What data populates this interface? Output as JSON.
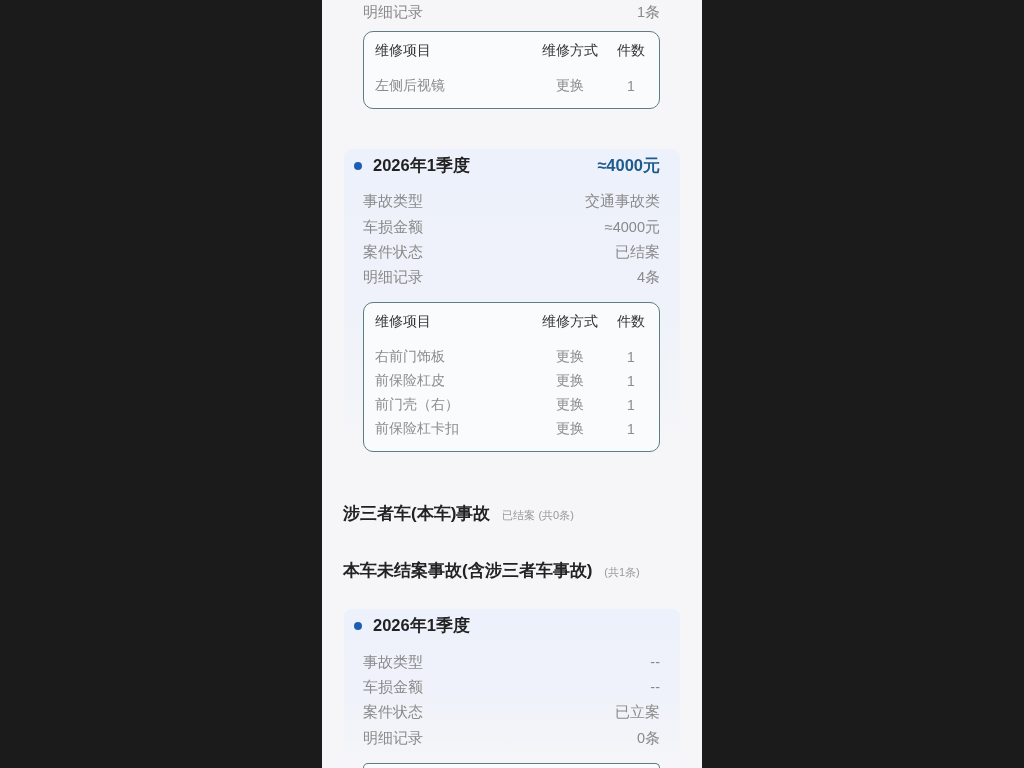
{
  "items": [
    {
      "kind": "record",
      "details": [
        {
          "label": "明细记录",
          "value": "1条"
        }
      ],
      "repairs": {
        "columns": [
          "维修项目",
          "维修方式",
          "件数"
        ],
        "rows": [
          {
            "item": "左侧后视镜",
            "method": "更换",
            "count": "1"
          }
        ]
      }
    },
    {
      "kind": "record",
      "period": "2026年1季度",
      "amount": "≈4000元",
      "details": [
        {
          "label": "事故类型",
          "value": "交通事故类"
        },
        {
          "label": "车损金额",
          "value": "≈4000元"
        },
        {
          "label": "案件状态",
          "value": "已结案"
        },
        {
          "label": "明细记录",
          "value": "4条"
        }
      ],
      "repairs": {
        "columns": [
          "维修项目",
          "维修方式",
          "件数"
        ],
        "rows": [
          {
            "item": "右前门饰板",
            "method": "更换",
            "count": "1"
          },
          {
            "item": "前保险杠皮",
            "method": "更换",
            "count": "1"
          },
          {
            "item": "前门壳（右）",
            "method": "更换",
            "count": "1"
          },
          {
            "item": "前保险杠卡扣",
            "method": "更换",
            "count": "1"
          }
        ]
      }
    },
    {
      "kind": "section",
      "title": "涉三者车(本车)事故",
      "note": "已结案 (共0条)"
    },
    {
      "kind": "section",
      "title": "本车未结案事故(含涉三者车事故)",
      "note": "(共1条)"
    },
    {
      "kind": "record",
      "period": "2026年1季度",
      "details": [
        {
          "label": "事故类型",
          "value": "--"
        },
        {
          "label": "车损金额",
          "value": "--"
        },
        {
          "label": "案件状态",
          "value": "已立案"
        },
        {
          "label": "明细记录",
          "value": "0条"
        }
      ],
      "repairs_cut_off": true
    }
  ]
}
